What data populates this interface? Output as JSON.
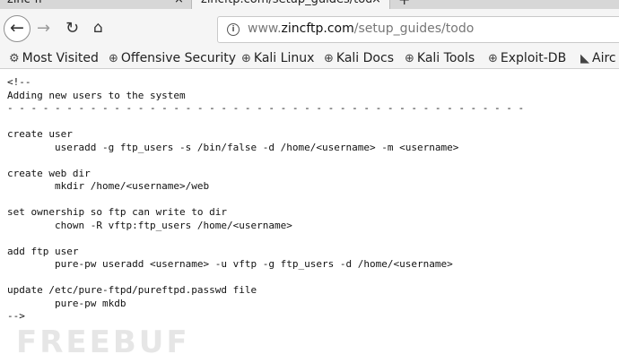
{
  "tabs": [
    {
      "title": "zinc-ff",
      "close": "×"
    },
    {
      "title": "zincftp.com/setup_guides/todo",
      "close": "×"
    }
  ],
  "new_tab": "+",
  "nav": {
    "back": "←",
    "forward": "→",
    "reload": "↻",
    "home": "⌂",
    "info": "i",
    "url_prefix": "www.",
    "url_host": "zincftp.com",
    "url_path": "/setup_guides/todo"
  },
  "bookmarks": [
    {
      "icon": "gear-icon",
      "label": "Most Visited"
    },
    {
      "icon": "globe-icon",
      "label": "Offensive Security"
    },
    {
      "icon": "globe-icon",
      "label": "Kali Linux"
    },
    {
      "icon": "globe-icon",
      "label": "Kali Docs"
    },
    {
      "icon": "globe-icon",
      "label": "Kali Tools"
    },
    {
      "icon": "globe-icon",
      "label": "Exploit-DB"
    },
    {
      "icon": "dragon-icon",
      "label": "Airc"
    }
  ],
  "content": "<!--\nAdding new users to the system\n- - - - - - - - - - - - - - - - - - - - - - - - - - - - - - - - - - - - - - - - - - - -\n\ncreate user\n        useradd -g ftp_users -s /bin/false -d /home/<username> -m <username>\n\ncreate web dir\n        mkdir /home/<username>/web\n\nset ownership so ftp can write to dir\n        chown -R vftp:ftp_users /home/<username>\n\nadd ftp user\n        pure-pw useradd <username> -u vftp -g ftp_users -d /home/<username>\n\nupdate /etc/pure-ftpd/pureftpd.passwd file\n        pure-pw mkdb\n-->",
  "watermark": "FREEBUF"
}
